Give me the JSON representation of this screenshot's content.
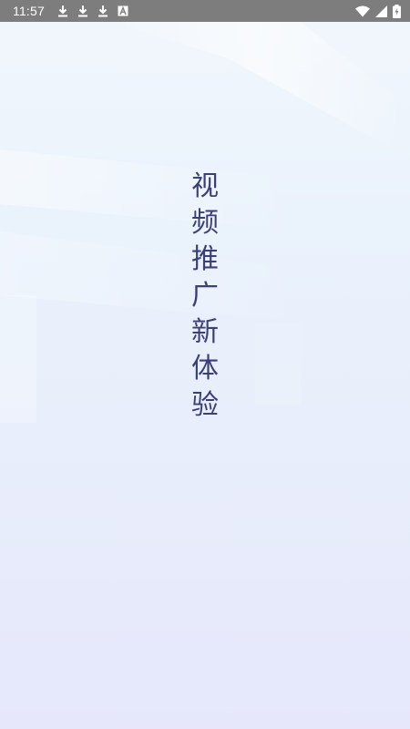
{
  "status_bar": {
    "time": "11:57",
    "left_icons": [
      "download-icon",
      "download-icon",
      "download-icon",
      "font-a-icon"
    ],
    "right_icons": [
      "wifi-icon",
      "signal-icon",
      "battery-charging-icon"
    ],
    "background_color": "#7d7d7d"
  },
  "splash": {
    "slogan_chars": [
      "视",
      "频",
      "推",
      "广",
      "新",
      "体",
      "验"
    ],
    "slogan_color": "#3a3f7a"
  }
}
